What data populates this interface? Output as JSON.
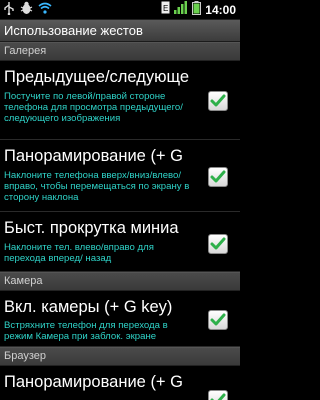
{
  "status_bar": {
    "time": "14:00",
    "icons": [
      "usb-icon",
      "bug-icon",
      "wifi-icon",
      "sim-icon",
      "signal-icon",
      "battery-icon"
    ]
  },
  "title": "Использование жестов",
  "sections": [
    {
      "header": "Галерея",
      "items": [
        {
          "title": "Предыдущее/следующе",
          "summary": "Постучите по левой/правой стороне телефона для просмотра предыдущего/следующего изображения",
          "checked": true
        },
        {
          "title": "Панорамирование (+ G",
          "summary": "Наклоните телефона вверх/вниз/влево/вправо, чтобы перемещаться по экрану в сторону наклона",
          "checked": true
        },
        {
          "title": "Быст. прокрутка миниа",
          "summary": "Наклоните тел. влево/вправо для перехода вперед/ назад",
          "checked": true
        }
      ]
    },
    {
      "header": "Камера",
      "items": [
        {
          "title": "Вкл. камеры (+ G key)",
          "summary": "Встряхните телефон для перехода в режим Камера при заблок. экране",
          "checked": true
        }
      ]
    },
    {
      "header": "Браузер",
      "items": [
        {
          "title": "Панорамирование (+ G",
          "summary": "",
          "checked": true
        }
      ]
    }
  ],
  "colors": {
    "summary": "#2fd3c8",
    "check": "#2eb04a",
    "background": "#000000"
  }
}
